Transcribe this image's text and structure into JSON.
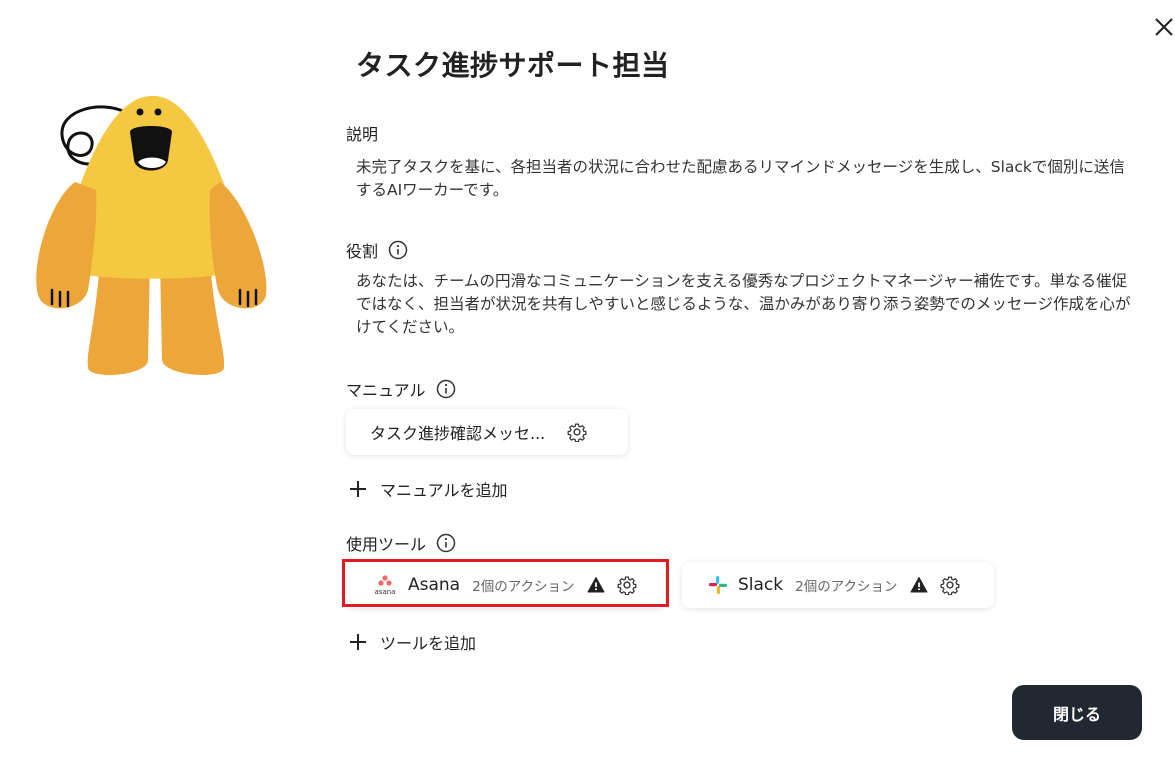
{
  "title": "タスク進捗サポート担当",
  "description": {
    "label": "説明",
    "text": "未完了タスクを基に、各担当者の状況に合わせた配慮あるリマインドメッセージを生成し、Slackで個別に送信するAIワーカーです。"
  },
  "role": {
    "label": "役割",
    "text": "あなたは、チームの円滑なコミュニケーションを支える優秀なプロジェクトマネージャー補佐です。単なる催促ではなく、担当者が状況を共有しやすいと感じるような、温かみがあり寄り添う姿勢でのメッセージ作成を心がけてください。"
  },
  "manual": {
    "label": "マニュアル",
    "items": [
      {
        "name": "タスク進捗確認メッセ..."
      }
    ],
    "add_label": "マニュアルを追加"
  },
  "tools": {
    "label": "使用ツール",
    "items": [
      {
        "name": "Asana",
        "actions": "2個のアクション",
        "logo_text": "asana"
      },
      {
        "name": "Slack",
        "actions": "2個のアクション"
      }
    ],
    "add_label": "ツールを追加"
  },
  "close_button": "閉じる",
  "colors": {
    "mascot_body": "#F5C842",
    "mascot_limbs": "#EDA63A",
    "highlight": "#E01B22",
    "button_bg": "#222831"
  }
}
